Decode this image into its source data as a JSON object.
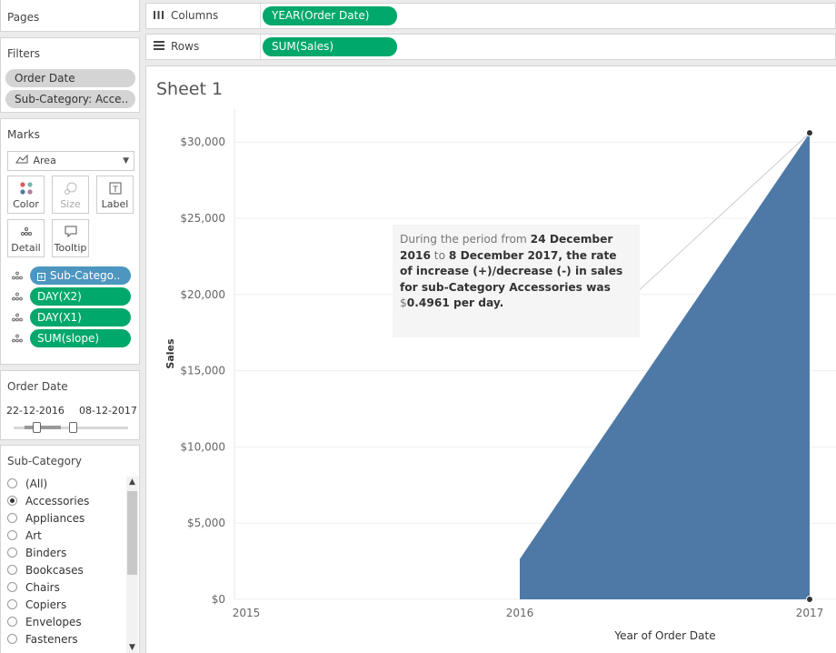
{
  "pages": {
    "title": "Pages"
  },
  "filters": {
    "title": "Filters",
    "items": [
      "Order Date",
      "Sub-Category: Acce.."
    ]
  },
  "marks": {
    "title": "Marks",
    "mark_type": "Area",
    "buttons": {
      "color": "Color",
      "size": "Size",
      "label": "Label",
      "detail": "Detail",
      "tooltip": "Tooltip"
    },
    "fields": [
      {
        "label": "Sub-Catego..",
        "color": "#4c96c0"
      },
      {
        "label": "DAY(X2)",
        "color": "#00a86b"
      },
      {
        "label": "DAY(X1)",
        "color": "#00a86b"
      },
      {
        "label": "SUM(slope)",
        "color": "#00a86b"
      }
    ]
  },
  "order_date_filter": {
    "title": "Order Date",
    "start": "22-12-2016",
    "end": "08-12-2017"
  },
  "subcategory_filter": {
    "title": "Sub-Category",
    "options": [
      "(All)",
      "Accessories",
      "Appliances",
      "Art",
      "Binders",
      "Bookcases",
      "Chairs",
      "Copiers",
      "Envelopes",
      "Fasteners"
    ],
    "selected": "Accessories"
  },
  "shelves": {
    "columns": {
      "label": "Columns",
      "pill": "YEAR(Order Date)"
    },
    "rows": {
      "label": "Rows",
      "pill": "SUM(Sales)"
    }
  },
  "sheet": {
    "title": "Sheet 1"
  },
  "tooltip": {
    "p1": "During the period from ",
    "d1": "24 December 2016",
    "p2": " to ",
    "d2": "8 December 2017, the rate of increase (+)/decrease (-) in sales for sub-Category Accessories was",
    "p3": " $",
    "v": "0.4961 per day."
  },
  "colors": {
    "area": "#4e79a7",
    "pill_green": "#00a86b",
    "pill_blue": "#4c96c0"
  },
  "chart_data": {
    "type": "area",
    "xlabel": "Year of Order Date",
    "ylabel": "Sales",
    "x_ticks": [
      "2015",
      "2016",
      "2017"
    ],
    "y_ticks": [
      "$0",
      "$5,000",
      "$10,000",
      "$15,000",
      "$20,000",
      "$25,000",
      "$30,000"
    ],
    "ylim": [
      0,
      30000
    ],
    "series": [
      {
        "x": [
          2016,
          2017
        ],
        "values": [
          2650,
          30600
        ]
      }
    ],
    "trend_line": {
      "from_y": 20500,
      "to_y": 30600
    }
  }
}
